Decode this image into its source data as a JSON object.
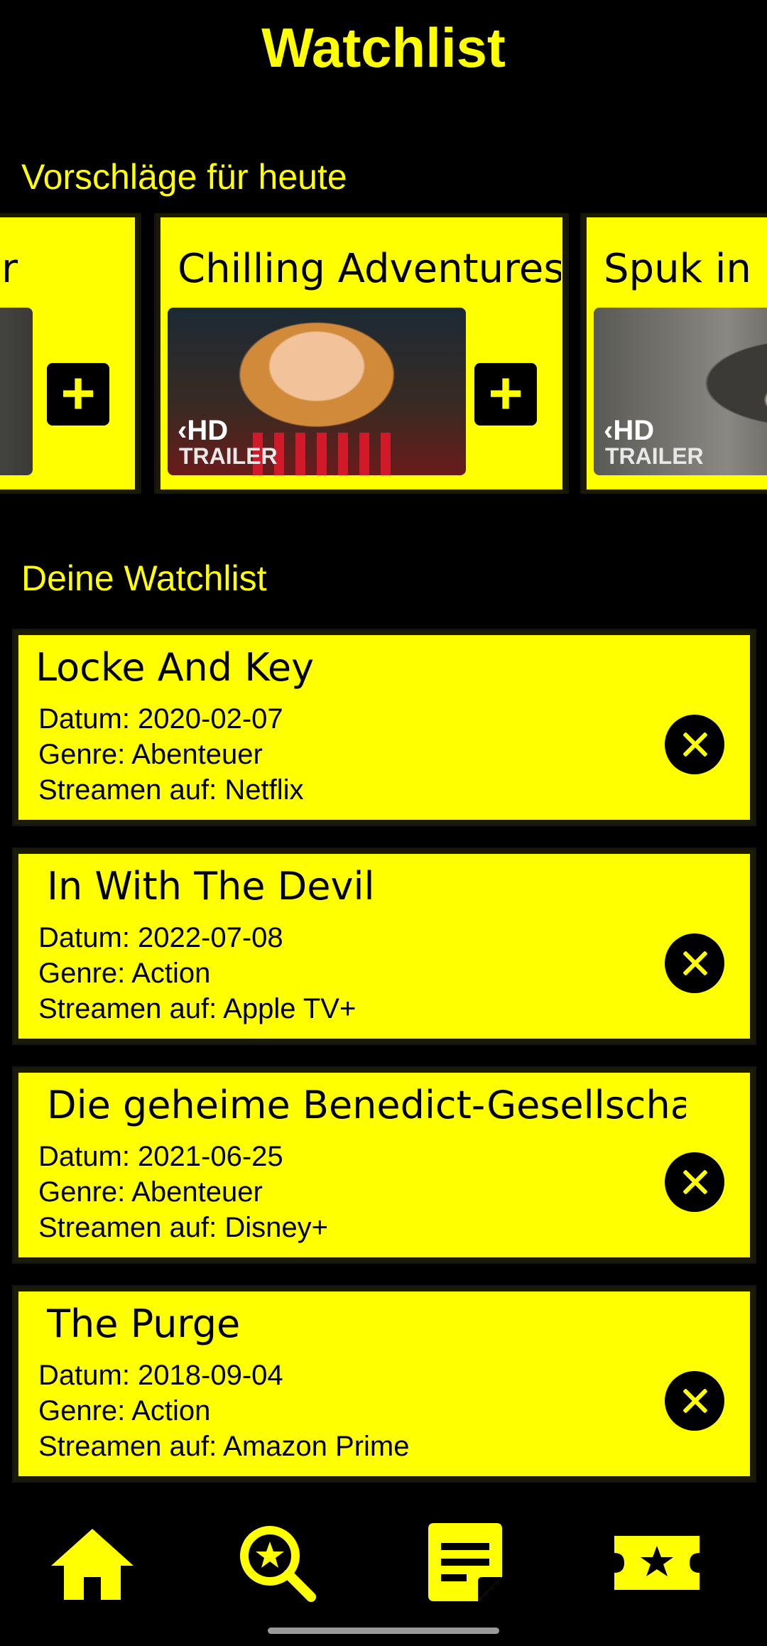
{
  "header": {
    "title": "Watchlist"
  },
  "suggestions": {
    "section_title": "Vorschläge für heute",
    "cards": [
      {
        "title": "r",
        "add_label": "+"
      },
      {
        "title": "Chilling Adventures of Sabrina",
        "hd": "HD",
        "trailer": "TRAILER",
        "add_label": "+"
      },
      {
        "title": "Spuk in Hill House",
        "hd": "HD",
        "trailer": "TRAILER"
      }
    ]
  },
  "watchlist": {
    "section_title": "Deine Watchlist",
    "items": [
      {
        "title": "Locke And Key",
        "date": "Datum: 2020-02-07",
        "genre": "Genre: Abenteuer",
        "stream": "Streamen auf: Netflix"
      },
      {
        "title": "In With The Devil",
        "date": "Datum: 2022-07-08",
        "genre": "Genre: Action",
        "stream": "Streamen auf: Apple TV+"
      },
      {
        "title": "Die geheime Benedict-Gesellschaft",
        "date": "Datum: 2021-06-25",
        "genre": "Genre: Abenteuer",
        "stream": "Streamen auf: Disney+"
      },
      {
        "title": "The Purge",
        "date": "Datum: 2018-09-04",
        "genre": "Genre: Action",
        "stream": "Streamen auf: Amazon Prime"
      }
    ]
  },
  "nav": {
    "items": [
      {
        "icon": "home-icon"
      },
      {
        "icon": "search-star-icon"
      },
      {
        "icon": "note-icon"
      },
      {
        "icon": "ticket-star-icon"
      }
    ]
  },
  "colors": {
    "accent": "#ffff00",
    "background": "#000000",
    "text_on_accent": "#000000"
  }
}
